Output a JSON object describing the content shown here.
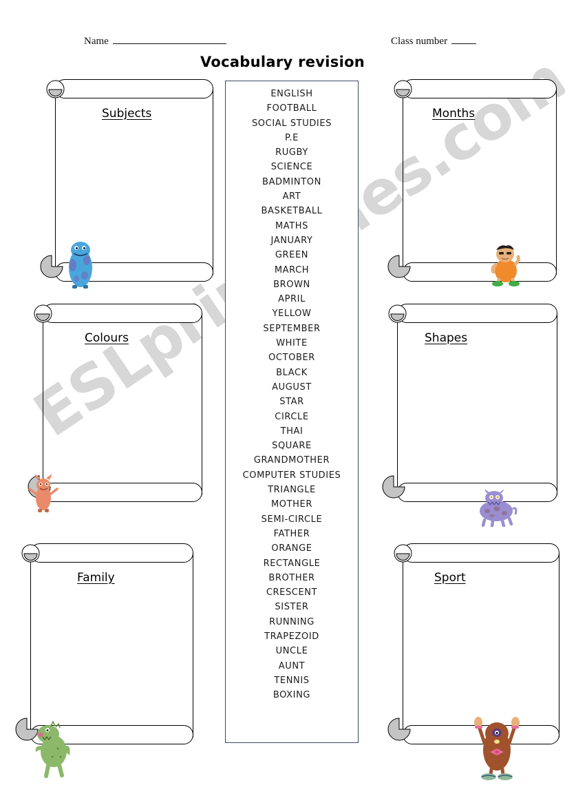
{
  "page": {
    "title": "Vocabulary revision",
    "watermark": "ESLprintables.com"
  },
  "header": {
    "name_label": "Name",
    "class_label": "Class number"
  },
  "word_bank": {
    "words": [
      "ENGLISH",
      "FOOTBALL",
      "SOCIAL STUDIES",
      "P.E",
      "RUGBY",
      "SCIENCE",
      "BADMINTON",
      "ART",
      "BASKETBALL",
      "MATHS",
      "JANUARY",
      "GREEN",
      "MARCH",
      "BROWN",
      "APRIL",
      "YELLOW",
      "SEPTEMBER",
      "WHITE",
      "OCTOBER",
      "BLACK",
      "AUGUST",
      "STAR",
      "CIRCLE",
      "THAI",
      "SQUARE",
      "GRANDMOTHER",
      "COMPUTER STUDIES",
      "TRIANGLE",
      "MOTHER",
      "SEMI-CIRCLE",
      "FATHER",
      "ORANGE",
      "RECTANGLE",
      "BROTHER",
      "CRESCENT",
      "SISTER",
      "RUNNING",
      "TRAPEZOID",
      "UNCLE",
      "AUNT",
      "TENNIS",
      "BOXING"
    ]
  },
  "categories": [
    {
      "key": "subjects",
      "label": "Subjects",
      "mascot": "blue-furry-monster-icon",
      "mascot_color": "#4aa8d8"
    },
    {
      "key": "colours",
      "label": "Colours",
      "mascot": "orange-monster-icon",
      "mascot_color": "#e98a6a"
    },
    {
      "key": "family",
      "label": "Family",
      "mascot": "green-dinosaur-monster-icon",
      "mascot_color": "#8cb86a"
    },
    {
      "key": "months",
      "label": "Months",
      "mascot": "orange-caveman-icon",
      "mascot_color": "#f08a2a"
    },
    {
      "key": "shapes",
      "label": "Shapes",
      "mascot": "purple-spotted-monster-icon",
      "mascot_color": "#9a8ed0"
    },
    {
      "key": "sport",
      "label": "Sport",
      "mascot": "brown-furry-monster-icon",
      "mascot_color": "#a0522d"
    }
  ],
  "colors": {
    "word_bank_border": "#3b4a63",
    "scroll_outline": "#000000",
    "curl_fill": "#c4c4c4",
    "watermark": "#c8c8c8"
  }
}
